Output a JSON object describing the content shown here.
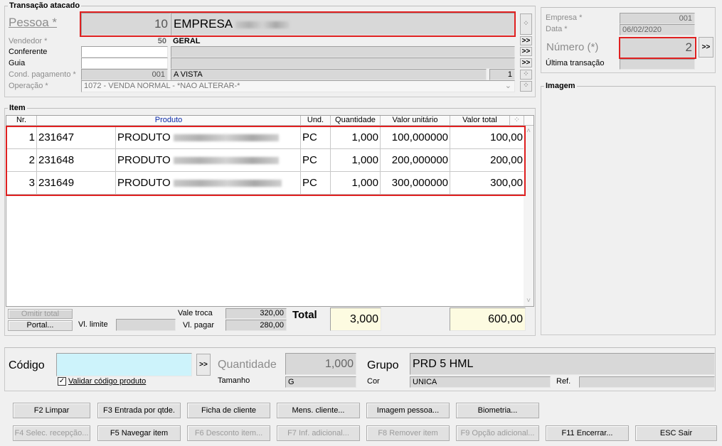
{
  "header": {
    "group_title": "Transação atacado",
    "pessoa_label": "Pessoa *",
    "pessoa_code": "10",
    "pessoa_name": "EMPRESA",
    "vendedor_label": "Vendedor *",
    "vendedor_code": "50",
    "vendedor_name": "GERAL",
    "conferente_label": "Conferente",
    "guia_label": "Guia",
    "cond_label": "Cond. pagamento *",
    "cond_code": "001",
    "cond_name": "A VISTA",
    "cond_parcelas": "1",
    "operacao_label": "Operação *",
    "operacao_value": "1072 - VENDA NORMAL - *NAO ALTERAR-*"
  },
  "right_panel": {
    "empresa_label": "Empresa *",
    "empresa_value": "001",
    "data_label": "Data *",
    "data_value": "06/02/2020",
    "numero_label": "Número (*)",
    "numero_value": "2",
    "ultima_label": "Última transação",
    "imagem_title": "Imagem"
  },
  "items": {
    "group_title": "Item",
    "columns": [
      "Nr.",
      "Produto",
      "Und.",
      "Quantidade",
      "Valor unitário",
      "Valor total"
    ],
    "rows": [
      {
        "nr": "1",
        "code": "231647",
        "desc": "PRODUTO",
        "und": "PC",
        "qtd": "1,000",
        "vunit": "100,000000",
        "vtotal": "100,00"
      },
      {
        "nr": "2",
        "code": "231648",
        "desc": "PRODUTO",
        "und": "PC",
        "qtd": "1,000",
        "vunit": "200,000000",
        "vtotal": "200,00"
      },
      {
        "nr": "3",
        "code": "231649",
        "desc": "PRODUTO",
        "und": "PC",
        "qtd": "1,000",
        "vunit": "300,000000",
        "vtotal": "300,00"
      }
    ]
  },
  "totals": {
    "omitir_total": "Omitir total",
    "portal": "Portal...",
    "vl_limite_label": "Vl. limite",
    "vale_troca_label": "Vale troca",
    "vale_troca_value": "320,00",
    "vl_pagar_label": "Vl. pagar",
    "vl_pagar_value": "280,00",
    "total_label": "Total",
    "total_qtd": "3,000",
    "total_valor": "600,00"
  },
  "entry": {
    "codigo_label": "Código",
    "validar_label": "Validar código produto",
    "quantidade_label": "Quantidade",
    "quantidade_value": "1,000",
    "tamanho_label": "Tamanho",
    "tamanho_value": "G",
    "grupo_label": "Grupo",
    "grupo_value": "PRD 5 HML",
    "cor_label": "Cor",
    "cor_value": "UNICA",
    "ref_label": "Ref."
  },
  "buttons": {
    "row1": [
      "F2 Limpar",
      "F3 Entrada por qtde.",
      "Ficha de cliente",
      "Mens. cliente...",
      "Imagem pessoa...",
      "Biometria..."
    ],
    "row2": [
      "F4 Selec. recepção...",
      "F5 Navegar item",
      "F6 Desconto item...",
      "F7 Inf. adicional...",
      "F8 Remover item",
      "F9 Opção adicional...",
      "F11 Encerrar...",
      "ESC Sair"
    ]
  },
  "colors": {
    "highlight_red": "#e02020",
    "codigo_bg": "#cdf3fb",
    "total_bg": "#fdfbe1"
  },
  "icons": {
    "expand": ">>",
    "ellipsis": "..."
  }
}
